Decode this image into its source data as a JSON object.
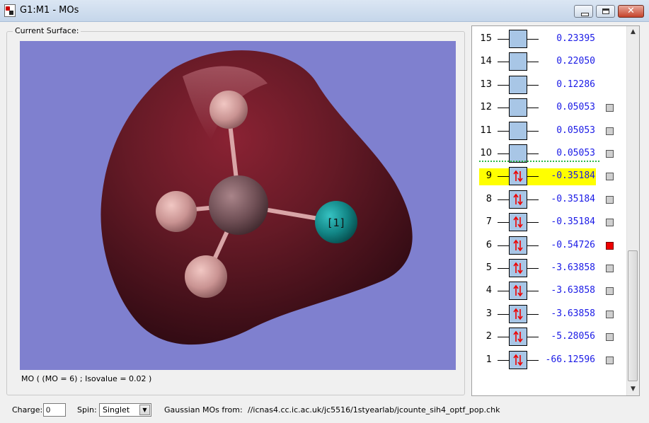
{
  "window": {
    "title": "G1:M1 - MOs",
    "buttons": {
      "minimize": "minimize-icon",
      "maximize": "maximize-icon",
      "close": "close-icon"
    }
  },
  "surface": {
    "group_label": "Current Surface:",
    "atom_label": "[1]",
    "caption": "MO ( (MO = 6) ; Isovalue = 0.02 )"
  },
  "orbitals": [
    {
      "num": "15",
      "energy": "0.23395",
      "occupied": false,
      "checkbox": false
    },
    {
      "num": "14",
      "energy": "0.22050",
      "occupied": false,
      "checkbox": false
    },
    {
      "num": "13",
      "energy": "0.12286",
      "occupied": false,
      "checkbox": false
    },
    {
      "num": "12",
      "energy": "0.05053",
      "occupied": false,
      "checkbox": true
    },
    {
      "num": "11",
      "energy": "0.05053",
      "occupied": false,
      "checkbox": true
    },
    {
      "num": "10",
      "energy": "0.05053",
      "occupied": false,
      "checkbox": true
    },
    {
      "num": "9",
      "energy": "-0.35184",
      "occupied": true,
      "checkbox": true,
      "highlight": true
    },
    {
      "num": "8",
      "energy": "-0.35184",
      "occupied": true,
      "checkbox": true
    },
    {
      "num": "7",
      "energy": "-0.35184",
      "occupied": true,
      "checkbox": true
    },
    {
      "num": "6",
      "energy": "-0.54726",
      "occupied": true,
      "checkbox": true,
      "selected": true
    },
    {
      "num": "5",
      "energy": "-3.63858",
      "occupied": true,
      "checkbox": true
    },
    {
      "num": "4",
      "energy": "-3.63858",
      "occupied": true,
      "checkbox": true
    },
    {
      "num": "3",
      "energy": "-3.63858",
      "occupied": true,
      "checkbox": true
    },
    {
      "num": "2",
      "energy": "-5.28056",
      "occupied": true,
      "checkbox": true
    },
    {
      "num": "1",
      "energy": "-66.12596",
      "occupied": true,
      "checkbox": true
    }
  ],
  "controls": {
    "charge_label": "Charge:",
    "charge_value": "0",
    "spin_label": "Spin:",
    "spin_value": "Singlet",
    "source_label": "Gaussian MOs from:",
    "source_path": "//icnas4.cc.ic.ac.uk/jc5516/1styearlab/jcounte_sih4_optf_pop.chk"
  },
  "colors": {
    "viewport_bg": "#7f80cf",
    "isosurface": "#5a1622",
    "energy_text": "#1a1ae6",
    "highlight": "#ffff00",
    "selected_check": "#ee0000",
    "homo_lumo_line": "#2db84a",
    "orbital_box": "#a8c6e6"
  }
}
